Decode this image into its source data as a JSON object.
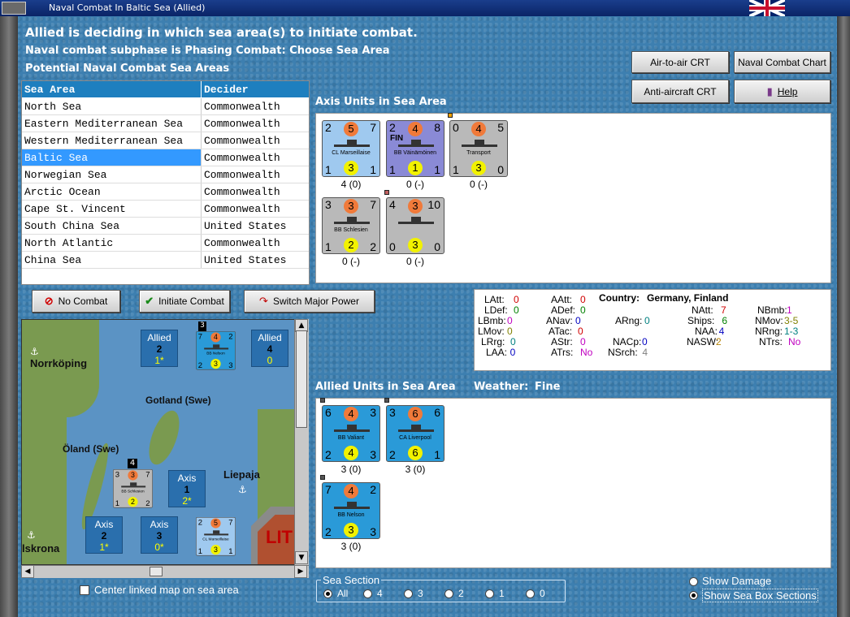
{
  "window": {
    "title": "Naval Combat In Baltic Sea (Allied)"
  },
  "header": {
    "line1": "Allied is deciding in which sea area(s) to initiate combat.",
    "line2": "Naval combat subphase is Phasing Combat: Choose Sea Area",
    "line3": "Potential Naval Combat Sea Areas"
  },
  "buttons": {
    "air_to_air": "Air-to-air CRT",
    "naval_chart": "Naval Combat Chart",
    "anti_aircraft": "Anti-aircraft CRT",
    "help": "Help",
    "no_combat": "No Combat",
    "initiate": "Initiate Combat",
    "switch_major": "Switch Major Power"
  },
  "sea_table": {
    "headers": [
      "Sea Area",
      "Decider"
    ],
    "rows": [
      [
        "North Sea",
        "Commonwealth"
      ],
      [
        "Eastern Mediterranean Sea",
        "Commonwealth"
      ],
      [
        "Western Mediterranean Sea",
        "Commonwealth"
      ],
      [
        "Baltic Sea",
        "Commonwealth"
      ],
      [
        "Norwegian Sea",
        "Commonwealth"
      ],
      [
        "Arctic Ocean",
        "Commonwealth"
      ],
      [
        "Cape St. Vincent",
        "Commonwealth"
      ],
      [
        "South China Sea",
        "United States"
      ],
      [
        "North Atlantic",
        "Commonwealth"
      ],
      [
        "China Sea",
        "United States"
      ]
    ],
    "selected_index": 3
  },
  "axis": {
    "title": "Axis Units in Sea Area",
    "units": [
      {
        "tl": "2",
        "tm": "5",
        "tr": "7",
        "name": "CL Marseillaise",
        "tag": "",
        "bl": "1",
        "bm": "3",
        "br": "1",
        "cap": "4 (0)"
      },
      {
        "tl": "2",
        "tm": "4",
        "tr": "8",
        "name": "BB Väinämöinen",
        "tag": "FIN",
        "bl": "1",
        "bm": "1",
        "br": "1",
        "cap": "0 (-)"
      },
      {
        "tl": "0",
        "tm": "4",
        "tr": "5",
        "name": "Transport",
        "tag": "",
        "bl": "1",
        "bm": "3",
        "br": "0",
        "cap": "0 (-)"
      },
      {
        "tl": "3",
        "tm": "3",
        "tr": "7",
        "name": "BB Schlesien",
        "tag": "",
        "bl": "1",
        "bm": "2",
        "br": "2",
        "cap": "0 (-)"
      },
      {
        "tl": "4",
        "tm": "3",
        "tr": "10",
        "name": "",
        "tag": "",
        "bl": "0",
        "bm": "3",
        "br": "0",
        "cap": "0 (-)"
      }
    ]
  },
  "stats": {
    "country_label": "Country:",
    "country_value": "Germany, Finland",
    "items": [
      {
        "label": "LAtt:",
        "value": "0",
        "color": "#d00000"
      },
      {
        "label": "LDef:",
        "value": "0",
        "color": "#008000"
      },
      {
        "label": "LBmb:",
        "value": "0",
        "color": "#c000c0"
      },
      {
        "label": "LMov:",
        "value": "0",
        "color": "#808000"
      },
      {
        "label": "LRrg:",
        "value": "0",
        "color": "#008080"
      },
      {
        "label": "LAA:",
        "value": "0",
        "color": "#0000c0"
      },
      {
        "label": "AAtt:",
        "value": "0",
        "color": "#d00000"
      },
      {
        "label": "ADef:",
        "value": "0",
        "color": "#008000"
      },
      {
        "label": "ANav:",
        "value": "0",
        "color": "#0000c0"
      },
      {
        "label": "ATac:",
        "value": "0",
        "color": "#d00000"
      },
      {
        "label": "AStr:",
        "value": "0",
        "color": "#c000c0"
      },
      {
        "label": "ATrs:",
        "value": "No",
        "color": "#c000c0"
      },
      {
        "label": "ARng:",
        "value": "0",
        "color": "#008080"
      },
      {
        "label": "NACp:",
        "value": "0",
        "color": "#0000c0"
      },
      {
        "label": "NSrch:",
        "value": "4",
        "color": "#808080"
      },
      {
        "label": "NAtt:",
        "value": "7",
        "color": "#d00000"
      },
      {
        "label": "Ships:",
        "value": "6",
        "color": "#008000"
      },
      {
        "label": "NAA:",
        "value": "4",
        "color": "#0000c0"
      },
      {
        "label": "NASW:",
        "value": "2",
        "color": "#b8860b"
      },
      {
        "label": "NBmb:",
        "value": "1",
        "color": "#c000c0"
      },
      {
        "label": "NMov:",
        "value": "3-5",
        "color": "#808000"
      },
      {
        "label": "NRng:",
        "value": "1-3",
        "color": "#008080"
      },
      {
        "label": "NTrs:",
        "value": "No",
        "color": "#c000c0"
      }
    ]
  },
  "allied": {
    "title": "Allied Units in Sea Area",
    "weather_label": "Weather:",
    "weather_value": "Fine",
    "units": [
      {
        "tl": "6",
        "tm": "4",
        "tr": "3",
        "name": "BB Valiant",
        "bl": "2",
        "bm": "4",
        "br": "3",
        "cap": "3 (0)"
      },
      {
        "tl": "3",
        "tm": "6",
        "tr": "6",
        "name": "CA Liverpool",
        "bl": "2",
        "bm": "6",
        "br": "1",
        "cap": "3 (0)"
      },
      {
        "tl": "7",
        "tm": "4",
        "tr": "2",
        "name": "BB Nelson",
        "bl": "2",
        "bm": "3",
        "br": "3",
        "cap": "3 (0)"
      }
    ]
  },
  "map": {
    "labels": {
      "norrkoping": "Norrköping",
      "gotland": "Gotland (Swe)",
      "oland": "Öland (Swe)",
      "liepaja": "Liepaja",
      "karlskrona": "lskrona",
      "lit": "LIT"
    },
    "boxes": [
      {
        "t": "Allied",
        "v": "2",
        "s": "1*"
      },
      {
        "t": "Allied",
        "v": "4",
        "s": "0"
      },
      {
        "t": "Axis",
        "v": "1",
        "s": "2*"
      },
      {
        "t": "Axis",
        "v": "2",
        "s": "1*"
      },
      {
        "t": "Axis",
        "v": "3",
        "s": "0*"
      }
    ],
    "stack_counts": [
      "3",
      "4"
    ],
    "counters": [
      {
        "tl": "7",
        "tm": "4",
        "tr": "2",
        "name": "BB Nelson",
        "bl": "2",
        "bm": "3",
        "br": "3"
      },
      {
        "tl": "3",
        "tm": "3",
        "tr": "7",
        "name": "BB Schlesien",
        "bl": "1",
        "bm": "2",
        "br": "2"
      },
      {
        "tl": "2",
        "tm": "5",
        "tr": "7",
        "name": "CL Marseillaise",
        "bl": "1",
        "bm": "3",
        "br": "1"
      }
    ]
  },
  "options": {
    "center_map": "Center linked map on sea area",
    "show_damage": "Show Damage",
    "show_sections": "Show Sea Box Sections"
  },
  "sea_section": {
    "legend": "Sea Section",
    "options": [
      "All",
      "4",
      "3",
      "2",
      "1",
      "0"
    ],
    "selected": "All"
  },
  "colors": {
    "background": "#3d7fb0",
    "axis_light_blue": "#9fc9ef",
    "finnish_purple": "#8a8ad6",
    "neutral_grey": "#b9b9b9",
    "allied_blue": "#2a9ad8",
    "selection": "#3399ff"
  }
}
